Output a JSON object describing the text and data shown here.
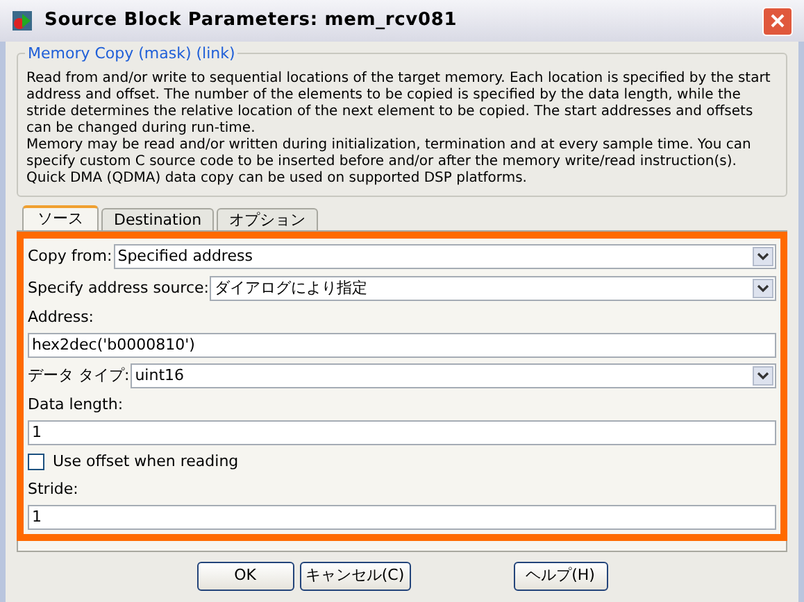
{
  "window": {
    "title": "Source Block Parameters: mem_rcv081"
  },
  "group": {
    "title": "Memory Copy (mask) (link)",
    "paragraphs": [
      "Read from and/or write to sequential locations of the target memory. Each location is specified by the start address and offset. The number of the elements to be copied is specified by the data length, while the stride determines the relative location of the next element to be copied. The start addresses and offsets can be changed during run-time.",
      "Memory may be read and/or written during initialization, termination and at every sample time. You can specify custom C source code to be inserted before and/or after the memory write/read instruction(s). Quick DMA (QDMA) data copy can be used on supported DSP platforms."
    ]
  },
  "tabs": [
    {
      "label": "ソース",
      "selected": true
    },
    {
      "label": "Destination",
      "selected": false
    },
    {
      "label": "オプション",
      "selected": false
    }
  ],
  "params": [
    {
      "kind": "select",
      "label": "Copy from:",
      "value": "Specified address"
    },
    {
      "kind": "select",
      "label": "Specify address source:",
      "value": "ダイアログにより指定"
    },
    {
      "kind": "text",
      "label": "Address:",
      "value": "hex2dec('b0000810')"
    },
    {
      "kind": "select",
      "label": "データ タイプ:",
      "value": "uint16"
    },
    {
      "kind": "text",
      "label": "Data length:",
      "value": "1"
    },
    {
      "kind": "checkbox",
      "label": "Use offset when reading",
      "checked": false
    },
    {
      "kind": "text",
      "label": "Stride:",
      "value": "1"
    }
  ],
  "buttons": [
    "OK",
    "キャンセル(C)",
    "ヘルプ(H)"
  ]
}
